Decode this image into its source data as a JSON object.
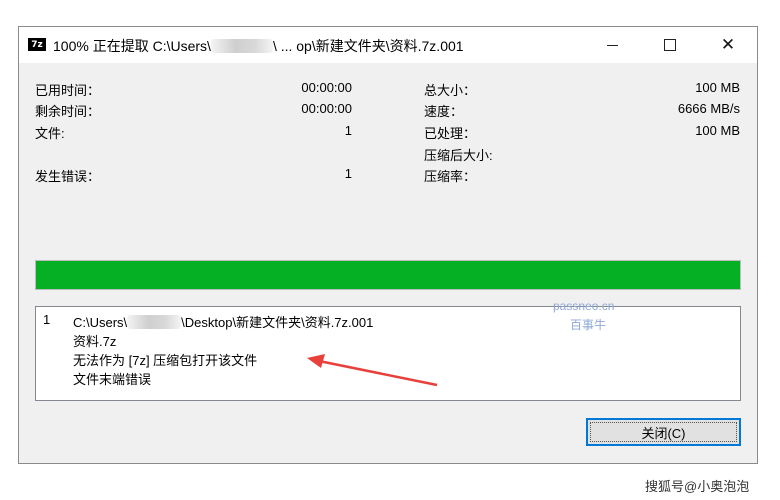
{
  "window": {
    "app_icon": "7z",
    "title_prefix": "100% 正在提取 C:\\Users\\",
    "title_suffix": "\\ ... op\\新建文件夹\\资料.7z.001",
    "colors": {
      "progress": "#06b025",
      "focus_border": "#0078d7",
      "annotation_arrow": "#e8403a"
    }
  },
  "stats": {
    "elapsed_label": "已用时间：",
    "elapsed_value": "00:00:00",
    "remaining_label": "剩余时间：",
    "remaining_value": "00:00:00",
    "files_label": "文件:",
    "files_value": "1",
    "errors_label": "发生错误：",
    "errors_value": "1",
    "total_label": "总大小：",
    "total_value": "100 MB",
    "speed_label": "速度：",
    "speed_value": "6666 MB/s",
    "processed_label": "已处理：",
    "processed_value": "100 MB",
    "compressed_label": "压缩后大小:",
    "ratio_label": "压缩率："
  },
  "progress": {
    "fraction": 1.0
  },
  "log": {
    "index": "1",
    "path_prefix": "C:\\Users\\",
    "path_suffix": "\\Desktop\\新建文件夹\\资料.7z.001",
    "line2": "资料.7z",
    "line3": "无法作为 [7z] 压缩包打开该文件",
    "line4": "文件末端错误",
    "watermark_site": "passneo.cn",
    "watermark_name": "百事牛"
  },
  "buttons": {
    "close_label": "关闭(C)"
  },
  "corner_watermark": "搜狐号@小奥泡泡",
  "icons": {
    "minimize": "minimize-icon",
    "maximize": "maximize-icon",
    "close": "close-icon"
  }
}
